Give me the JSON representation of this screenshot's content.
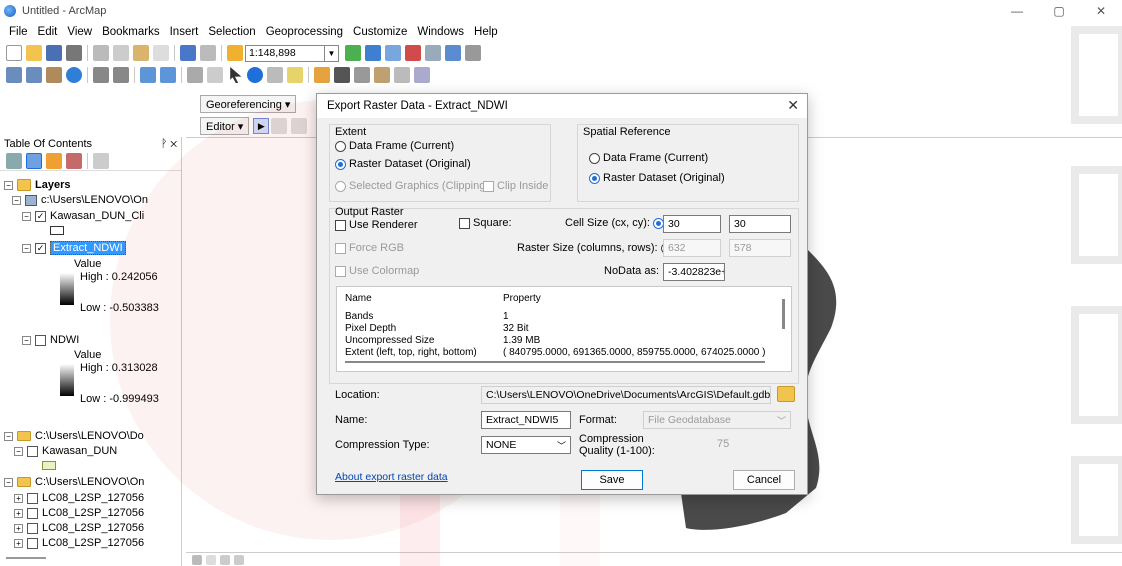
{
  "window": {
    "title": "Untitled - ArcMap",
    "controls": {
      "minimize": "—",
      "maximize": "▢",
      "close": "✕"
    }
  },
  "menu": [
    "File",
    "Edit",
    "View",
    "Bookmarks",
    "Insert",
    "Selection",
    "Geoprocessing",
    "Customize",
    "Windows",
    "Help"
  ],
  "toolbar": {
    "scale": "1:148,898"
  },
  "georef": {
    "label": "Georeferencing ▾"
  },
  "editor": {
    "label": "Editor ▾"
  },
  "toc": {
    "title": "Table Of Contents",
    "pin": "ᚹ ✕",
    "layers_label": "Layers",
    "gdb_path": "c:\\Users\\LENOVO\\On",
    "kawasan_clip": "Kawasan_DUN_Cli",
    "extract_ndwi": "Extract_NDWI",
    "value1": "Value",
    "high1": "High : 0.242056",
    "low1": "Low : -0.503383",
    "ndwi": "NDWI",
    "value2": "Value",
    "high2": "High : 0.313028",
    "low2": "Low : -0.999493",
    "folder1": "C:\\Users\\LENOVO\\Do",
    "kawasan_dun": "Kawasan_DUN",
    "folder2": "C:\\Users\\LENOVO\\On",
    "lc08": [
      "LC08_L2SP_127056",
      "LC08_L2SP_127056",
      "LC08_L2SP_127056",
      "LC08_L2SP_127056"
    ]
  },
  "dialog": {
    "title": "Export Raster Data - Extract_NDWI",
    "extent": {
      "label": "Extent",
      "opt_frame": "Data Frame (Current)",
      "opt_dataset": "Raster Dataset (Original)",
      "opt_selected": "Selected Graphics (Clipping)",
      "clip_inside": "Clip Inside"
    },
    "spatial": {
      "label": "Spatial Reference",
      "opt_frame": "Data Frame (Current)",
      "opt_dataset": "Raster Dataset (Original)"
    },
    "output": {
      "label": "Output Raster",
      "use_renderer": "Use Renderer",
      "square": "Square:",
      "cell_size_label": "Cell Size (cx, cy):",
      "cell_cx": "30",
      "cell_cy": "30",
      "force_rgb": "Force RGB",
      "raster_size_label": "Raster Size (columns, rows):",
      "cols": "632",
      "rows": "578",
      "use_colormap": "Use Colormap",
      "nodata_label": "NoData as:",
      "nodata_value": "-3.402823e+:"
    },
    "properties": {
      "col_name": "Name",
      "col_prop": "Property",
      "rows": [
        {
          "name": "Bands",
          "value": "1"
        },
        {
          "name": "Pixel Depth",
          "value": "32 Bit"
        },
        {
          "name": "Uncompressed Size",
          "value": "1.39 MB"
        },
        {
          "name": "Extent (left, top, right, bottom)",
          "value": "( 840795.0000, 691365.0000, 859755.0000, 674025.0000 )"
        }
      ]
    },
    "location_label": "Location:",
    "location_value": "C:\\Users\\LENOVO\\OneDrive\\Documents\\ArcGIS\\Default.gdb",
    "name_label": "Name:",
    "name_value": "Extract_NDWI5",
    "format_label": "Format:",
    "format_value": "File Geodatabase",
    "compression_label": "Compression Type:",
    "compression_value": "NONE",
    "quality_label": "Compression Quality (1-100):",
    "quality_value": "75",
    "about_link": "About export raster data",
    "save": "Save",
    "cancel": "Cancel"
  },
  "colors": {
    "accent": "#1e6fd9",
    "selection": "#3399ff"
  }
}
